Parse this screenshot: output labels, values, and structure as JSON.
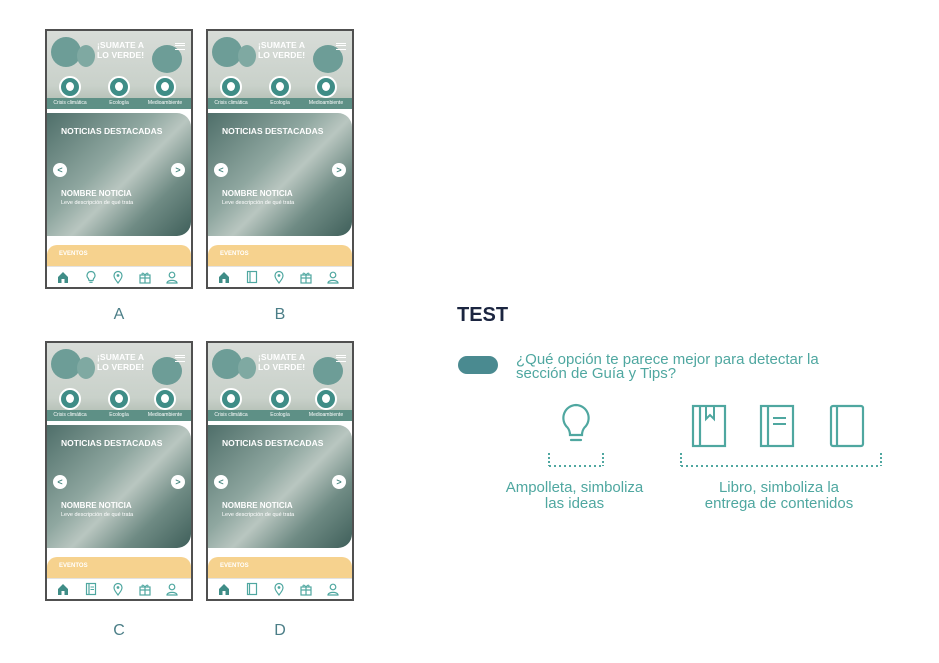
{
  "test": {
    "title": "TEST",
    "question": "¿Qué opción te parece mejor para detectar la\nsección de Guía y Tips?",
    "options": [
      {
        "icon": "lightbulb-icon",
        "caption": "Ampolleta, simboliza\nlas ideas"
      },
      {
        "icon": "book-icon",
        "caption": "Libro, simboliza la\nentrega de contenidos"
      }
    ]
  },
  "mockups": [
    {
      "label": "A",
      "guide_icon": "lightbulb-icon"
    },
    {
      "label": "B",
      "guide_icon": "book-icon"
    },
    {
      "label": "C",
      "guide_icon": "book-icon"
    },
    {
      "label": "D",
      "guide_icon": "book-icon"
    }
  ],
  "app": {
    "hero_title": "¡SUMATE A\nLO VERDE!",
    "categories": [
      "Crisis climática",
      "Ecología",
      "Medioambiente"
    ],
    "news_heading": "NOTICIAS DESTACADAS",
    "news_name": "NOMBRE NOTICIA",
    "news_description": "Leve descripción de qué trata",
    "events_label": "EVENTOS",
    "prev_arrow": "<",
    "next_arrow": ">",
    "nav_icons": [
      "home-icon",
      "guide-icon",
      "map-pin-icon",
      "gift-icon",
      "user-icon"
    ]
  },
  "colors": {
    "accent": "#4fa7a0",
    "teal_dark": "#3f8d87",
    "events_yellow": "#f6d28e",
    "title_navy": "#1b2540"
  }
}
